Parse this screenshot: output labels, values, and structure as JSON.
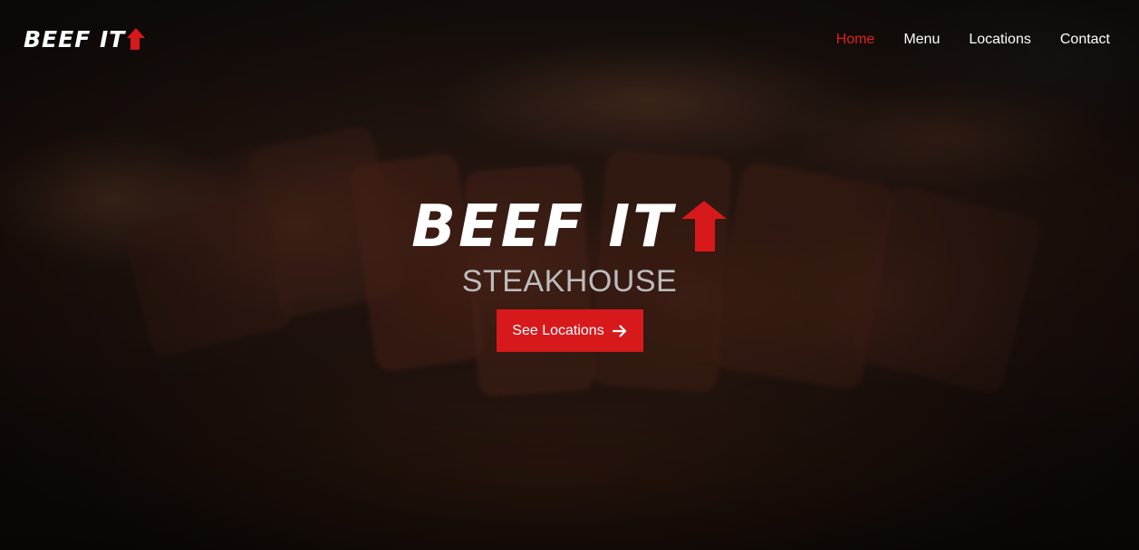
{
  "brand": {
    "logo_text": "BEEF IT",
    "accent_color": "#d7191c"
  },
  "nav": {
    "items": [
      {
        "label": "Home",
        "active": true
      },
      {
        "label": "Menu",
        "active": false
      },
      {
        "label": "Locations",
        "active": false
      },
      {
        "label": "Contact",
        "active": false
      }
    ],
    "active_color": "#e02020"
  },
  "hero": {
    "logo_text": "BEEF IT",
    "subtitle": "STEAKHOUSE",
    "cta_label": "See Locations",
    "cta_icon": "arrow-right-icon",
    "background_image": "blurred-sliced-steak-photo"
  }
}
